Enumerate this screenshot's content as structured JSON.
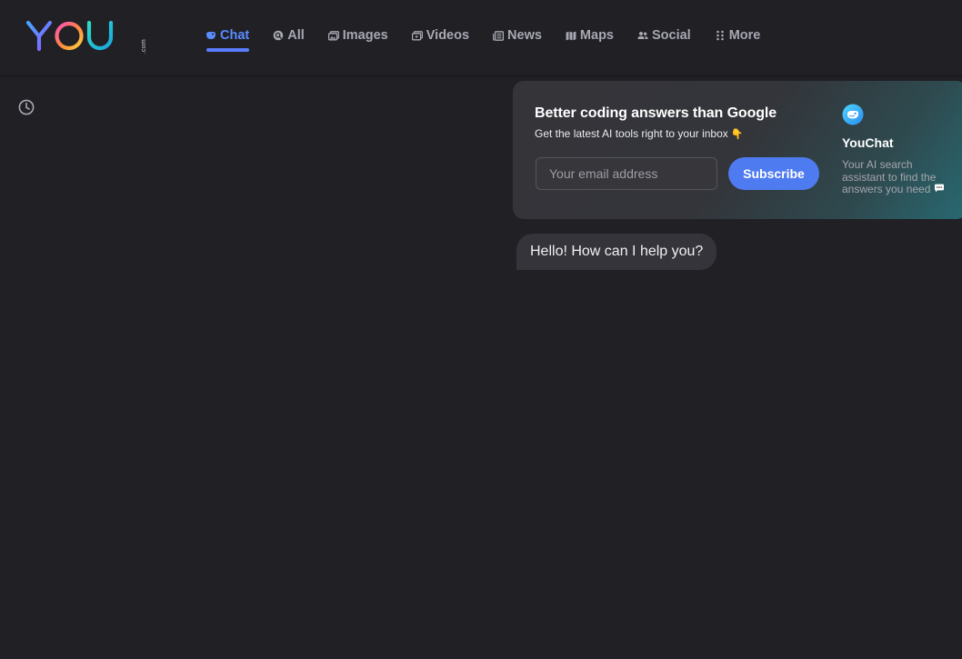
{
  "brand": {
    "logo_text": "YOU",
    "logo_suffix": ".com"
  },
  "nav": {
    "tabs": [
      {
        "label": "Chat",
        "icon": "chat-bird-icon",
        "active": true
      },
      {
        "label": "All",
        "icon": "search-icon",
        "active": false
      },
      {
        "label": "Images",
        "icon": "image-icon",
        "active": false
      },
      {
        "label": "Videos",
        "icon": "video-icon",
        "active": false
      },
      {
        "label": "News",
        "icon": "newspaper-icon",
        "active": false
      },
      {
        "label": "Maps",
        "icon": "map-icon",
        "active": false
      },
      {
        "label": "Social",
        "icon": "people-icon",
        "active": false
      },
      {
        "label": "More",
        "icon": "grid-dots-icon",
        "active": false
      }
    ]
  },
  "sidebar": {
    "history_icon": "clock-icon"
  },
  "promo": {
    "title": "Better coding answers than Google",
    "subtitle": "Get the latest AI tools right to your inbox",
    "subtitle_emoji": "👇",
    "email_placeholder": "Your email address",
    "email_value": "",
    "subscribe_label": "Subscribe",
    "youchat": {
      "title": "YouChat",
      "description": "Your AI search assistant to find the answers you need"
    }
  },
  "chat": {
    "messages": [
      {
        "role": "assistant",
        "text": "Hello! How can I help you?"
      }
    ]
  },
  "colors": {
    "background": "#202025",
    "accent": "#5b8cff",
    "subscribe": "#4f7bf0",
    "bubble": "#34343a"
  }
}
